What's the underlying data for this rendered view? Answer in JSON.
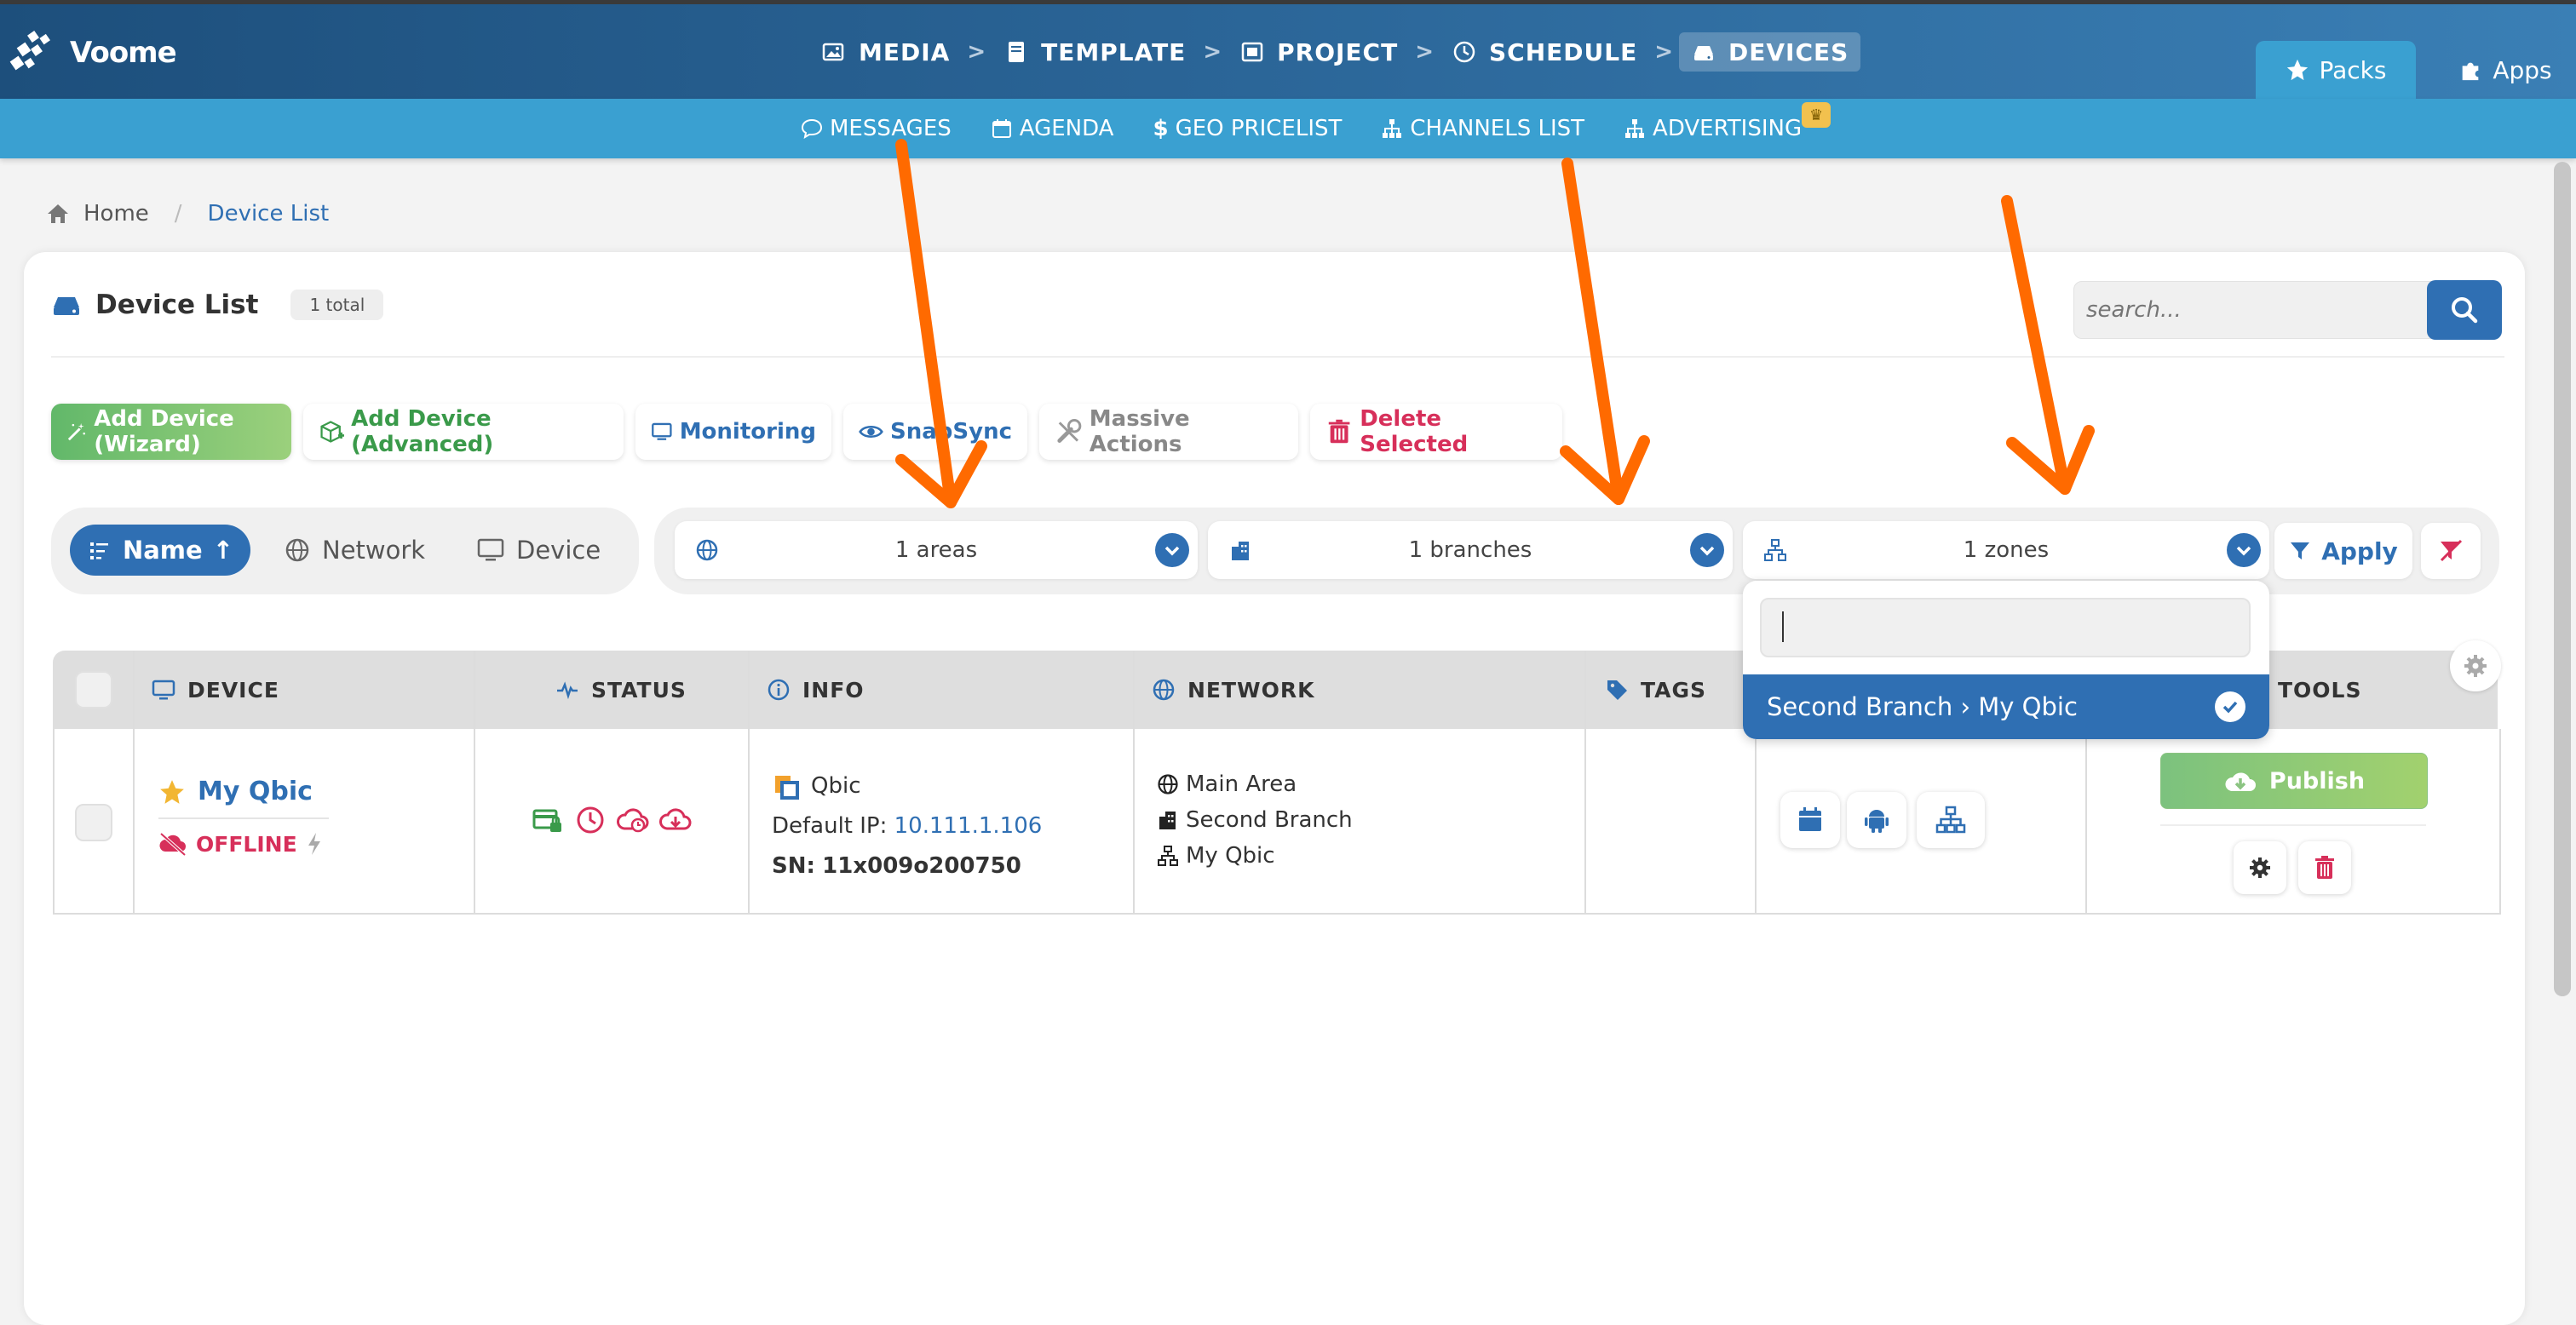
{
  "brand": {
    "name": "Voome"
  },
  "nav": {
    "steps": [
      {
        "label": "MEDIA",
        "icon": "images-icon"
      },
      {
        "label": "TEMPLATE",
        "icon": "book-icon"
      },
      {
        "label": "PROJECT",
        "icon": "project-icon"
      },
      {
        "label": "SCHEDULE",
        "icon": "clock-icon"
      },
      {
        "label": "DEVICES",
        "icon": "hdd-icon",
        "active": true
      }
    ],
    "packs_label": "Packs",
    "apps_label": "Apps"
  },
  "subnav": {
    "items": [
      {
        "label": "MESSAGES",
        "icon": "chat-icon"
      },
      {
        "label": "AGENDA",
        "icon": "calendar-icon"
      },
      {
        "label": "GEO PRICELIST",
        "icon": "dollar-icon"
      },
      {
        "label": "CHANNELS LIST",
        "icon": "sitemap-icon"
      },
      {
        "label": "ADVERTISING",
        "icon": "sitemap-icon",
        "badge": "♛"
      }
    ]
  },
  "breadcrumb": {
    "home": "Home",
    "current": "Device List"
  },
  "page": {
    "title": "Device List",
    "total": "1 total"
  },
  "search": {
    "placeholder": "search..."
  },
  "actions": {
    "add_wizard": "Add Device (Wizard)",
    "add_advanced": "Add Device (Advanced)",
    "monitoring": "Monitoring",
    "snapsync": "SnapSync",
    "massive": "Massive Actions",
    "delete": "Delete Selected"
  },
  "sort": {
    "name": "Name",
    "network": "Network",
    "device": "Device",
    "direction": "↑"
  },
  "filters": {
    "areas": "1 areas",
    "branches": "1 branches",
    "zones": "1 zones",
    "apply": "Apply"
  },
  "zone_popup": {
    "search_value": "",
    "option": "Second Branch › My Qbic"
  },
  "table": {
    "headers": {
      "device": "DEVICE",
      "status": "STATUS",
      "info": "INFO",
      "network": "NETWORK",
      "tags": "TAGS",
      "tools": "TOOLS"
    },
    "row": {
      "name": "My Qbic",
      "state": "OFFLINE",
      "model": "Qbic",
      "ip_label": "Default IP:",
      "ip": "10.111.1.106",
      "sn_label": "SN:",
      "sn": "11x009o200750",
      "area": "Main Area",
      "branch": "Second Branch",
      "zone": "My Qbic",
      "publish": "Publish"
    }
  },
  "colors": {
    "primary": "#2f6fb3",
    "accent_bar": "#3aa0d1",
    "danger": "#d72f5a",
    "success": "#3a9a4a",
    "annotation_arrow": "#ff6a00"
  }
}
